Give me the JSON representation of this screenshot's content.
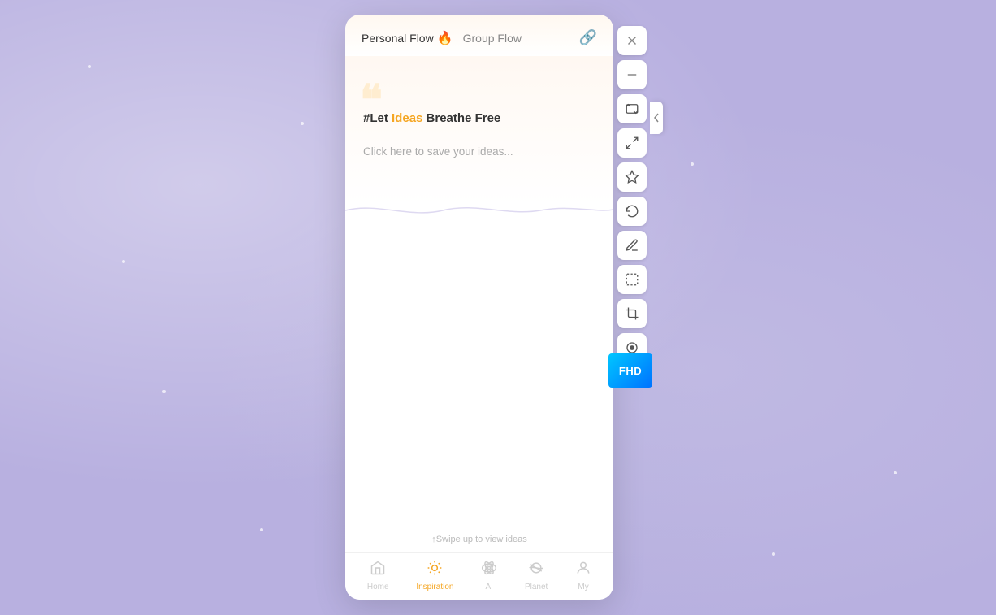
{
  "background": {
    "color": "#b8b0e0"
  },
  "tabs": [
    {
      "id": "personal",
      "label": "Personal Flow",
      "emoji": "🔥",
      "active": true
    },
    {
      "id": "group",
      "label": "Group Flow",
      "active": false
    }
  ],
  "header": {
    "link_icon": "🔗"
  },
  "content": {
    "quote_decoration": "❝",
    "headline_prefix": "#Let ",
    "headline_highlight": "Ideas",
    "headline_suffix": " Breathe Free",
    "subtext": "Click here to save your ideas...",
    "swipe_hint": "↑Swipe up to view ideas"
  },
  "toolbar": {
    "close_label": "×",
    "minimize_label": "−",
    "buttons": [
      {
        "id": "screenshot",
        "icon": "screenshot"
      },
      {
        "id": "expand",
        "icon": "expand"
      },
      {
        "id": "bookmark",
        "icon": "bookmark"
      },
      {
        "id": "undo",
        "icon": "undo"
      },
      {
        "id": "edit",
        "icon": "edit"
      },
      {
        "id": "border",
        "icon": "border"
      },
      {
        "id": "crop",
        "icon": "crop"
      },
      {
        "id": "record",
        "icon": "record"
      }
    ]
  },
  "fhd_badge": {
    "label": "FHD"
  },
  "bottom_nav": [
    {
      "id": "home",
      "label": "Home",
      "icon": "home",
      "active": false
    },
    {
      "id": "inspiration",
      "label": "Inspiration",
      "icon": "inspiration",
      "active": true
    },
    {
      "id": "ai",
      "label": "AI",
      "icon": "ai",
      "active": false
    },
    {
      "id": "planet",
      "label": "Planet",
      "icon": "planet",
      "active": false
    },
    {
      "id": "my",
      "label": "My",
      "icon": "my",
      "active": false
    }
  ]
}
